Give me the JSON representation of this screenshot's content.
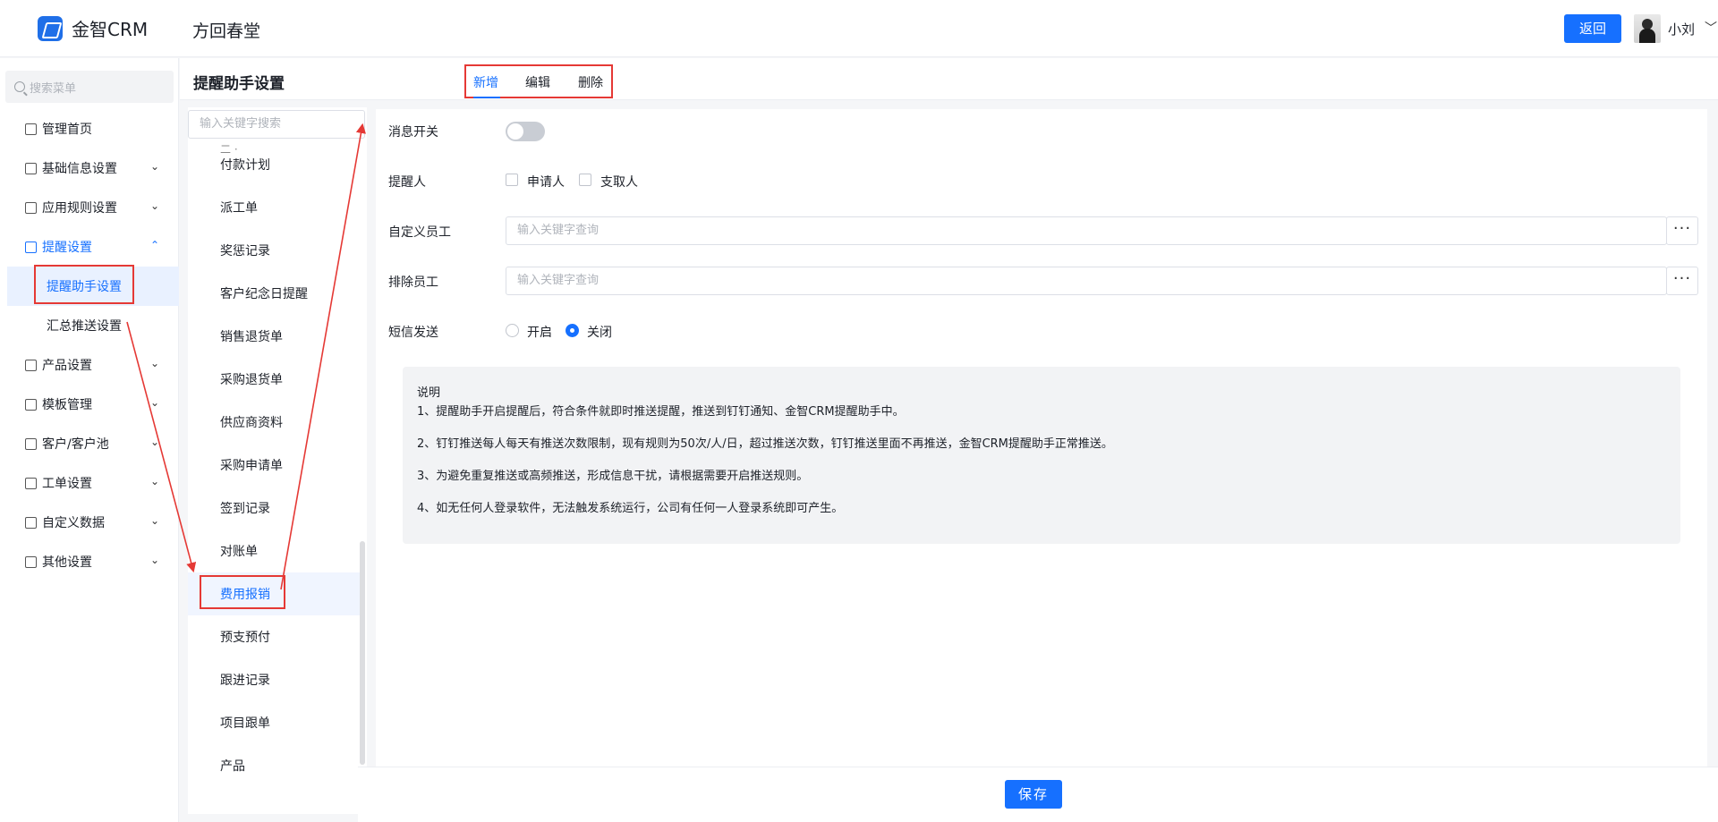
{
  "header": {
    "logo_text": "金智CRM",
    "company": "方回春堂",
    "back_label": "返回",
    "user_name": "小刘",
    "user_chevron": "﹀"
  },
  "sidebar": {
    "search_placeholder": "搜索菜单",
    "items": [
      {
        "label": "管理首页",
        "icon": "home-icon"
      },
      {
        "label": "基础信息设置",
        "icon": "cube-icon",
        "chevron": "⌄"
      },
      {
        "label": "应用规则设置",
        "icon": "document-icon",
        "chevron": "⌄"
      },
      {
        "label": "提醒设置",
        "icon": "bell-icon",
        "chevron": "⌃"
      },
      {
        "label": "提醒助手设置"
      },
      {
        "label": "汇总推送设置"
      },
      {
        "label": "产品设置",
        "icon": "cube-icon",
        "chevron": "⌄"
      },
      {
        "label": "模板管理",
        "icon": "template-icon",
        "chevron": "⌄"
      },
      {
        "label": "客户/客户池",
        "icon": "user-icon",
        "chevron": "⌄"
      },
      {
        "label": "工单设置",
        "icon": "ticket-icon",
        "chevron": "⌄"
      },
      {
        "label": "自定义数据",
        "icon": "tools-icon",
        "chevron": "⌄"
      },
      {
        "label": "其他设置",
        "icon": "grid-icon",
        "chevron": "⌄"
      }
    ]
  },
  "titlebar": {
    "title": "提醒助手设置",
    "tabs": [
      "新增",
      "编辑",
      "删除"
    ]
  },
  "list": {
    "search_placeholder": "输入关键字搜索",
    "partial_item": "二 ·",
    "items": [
      "付款计划",
      "派工单",
      "奖惩记录",
      "客户纪念日提醒",
      "销售退货单",
      "采购退货单",
      "供应商资料",
      "采购申请单",
      "签到记录",
      "对账单",
      "费用报销",
      "预支预付",
      "跟进记录",
      "项目跟单",
      "产品"
    ],
    "selected": "费用报销"
  },
  "form": {
    "message_switch_label": "消息开关",
    "message_switch_on": false,
    "reminder_label": "提醒人",
    "reminder_options": [
      "申请人",
      "支取人"
    ],
    "custom_staff_label": "自定义员工",
    "custom_staff_placeholder": "输入关键字查询",
    "exclude_staff_label": "排除员工",
    "exclude_staff_placeholder": "输入关键字查询",
    "more_label": "···",
    "sms_label": "短信发送",
    "sms_options": [
      "开启",
      "关闭"
    ],
    "sms_selected": "关闭",
    "note_title": "说明",
    "notes": [
      "1、提醒助手开启提醒后，符合条件就即时推送提醒，推送到钉钉通知、金智CRM提醒助手中。",
      "2、钉钉推送每人每天有推送次数限制，现有规则为50次/人/日，超过推送次数，钉钉推送里面不再推送，金智CRM提醒助手正常推送。",
      "3、为避免重复推送或高频推送，形成信息干扰，请根据需要开启推送规则。",
      "4、如无任何人登录软件，无法触发系统运行，公司有任何一人登录系统即可产生。"
    ]
  },
  "footer": {
    "save_label": "保存"
  },
  "colors": {
    "accent": "#1670ff",
    "annotation": "#e53935"
  }
}
